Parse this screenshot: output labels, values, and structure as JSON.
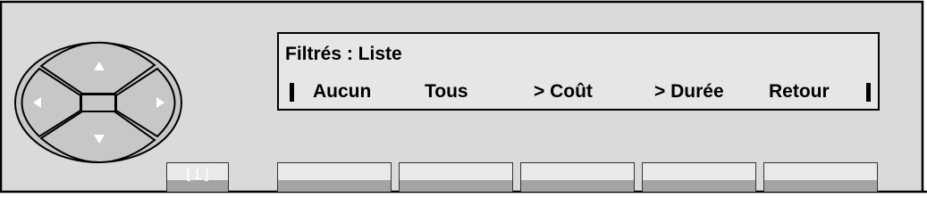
{
  "display": {
    "title": "Filtrés : Liste",
    "menu_items": [
      "Aucun",
      "Tous",
      "> Coût",
      "> Durée",
      "Retour"
    ]
  },
  "info_key": {
    "glyph": "[i]"
  },
  "colors": {
    "panel_bg": "#dadada",
    "lcd_bg": "#e6e6e6",
    "nav_bg": "#c7c7c7",
    "key_top": "#e9e9e9",
    "key_bottom": "#a4a4a4"
  },
  "icons": {
    "nav_up": "triangle-up",
    "nav_down": "triangle-down",
    "nav_left": "triangle-left",
    "nav_right": "triangle-right",
    "info": "info-icon"
  }
}
